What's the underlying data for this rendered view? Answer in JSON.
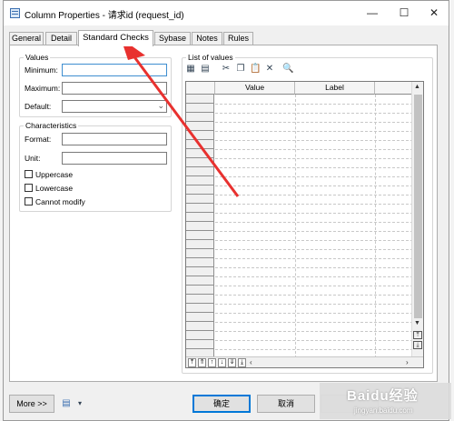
{
  "window": {
    "title": "Column Properties - 请求id (request_id)",
    "minimize_glyph": "—",
    "maximize_glyph": "☐",
    "close_glyph": "✕"
  },
  "tabs": [
    {
      "label": "General"
    },
    {
      "label": "Detail"
    },
    {
      "label": "Standard Checks"
    },
    {
      "label": "Sybase"
    },
    {
      "label": "Notes"
    },
    {
      "label": "Rules"
    }
  ],
  "values_group": {
    "title": "Values",
    "minimum_label": "Minimum:",
    "maximum_label": "Maximum:",
    "default_label": "Default:"
  },
  "characteristics_group": {
    "title": "Characteristics",
    "format_label": "Format:",
    "unit_label": "Unit:",
    "uppercase_label": "Uppercase",
    "lowercase_label": "Lowercase",
    "cannot_modify_label": "Cannot modify"
  },
  "list_of_values": {
    "title": "List of values",
    "columns": [
      "Value",
      "Label"
    ]
  },
  "buttons": {
    "more": "More >>",
    "ok": "确定",
    "cancel": "取消"
  },
  "watermark": {
    "line1": "Baidu经验",
    "line2": "jingyan.baidu.com"
  },
  "colors": {
    "annotation_arrow": "#e8312f",
    "focus_border": "#3e8ed0"
  }
}
